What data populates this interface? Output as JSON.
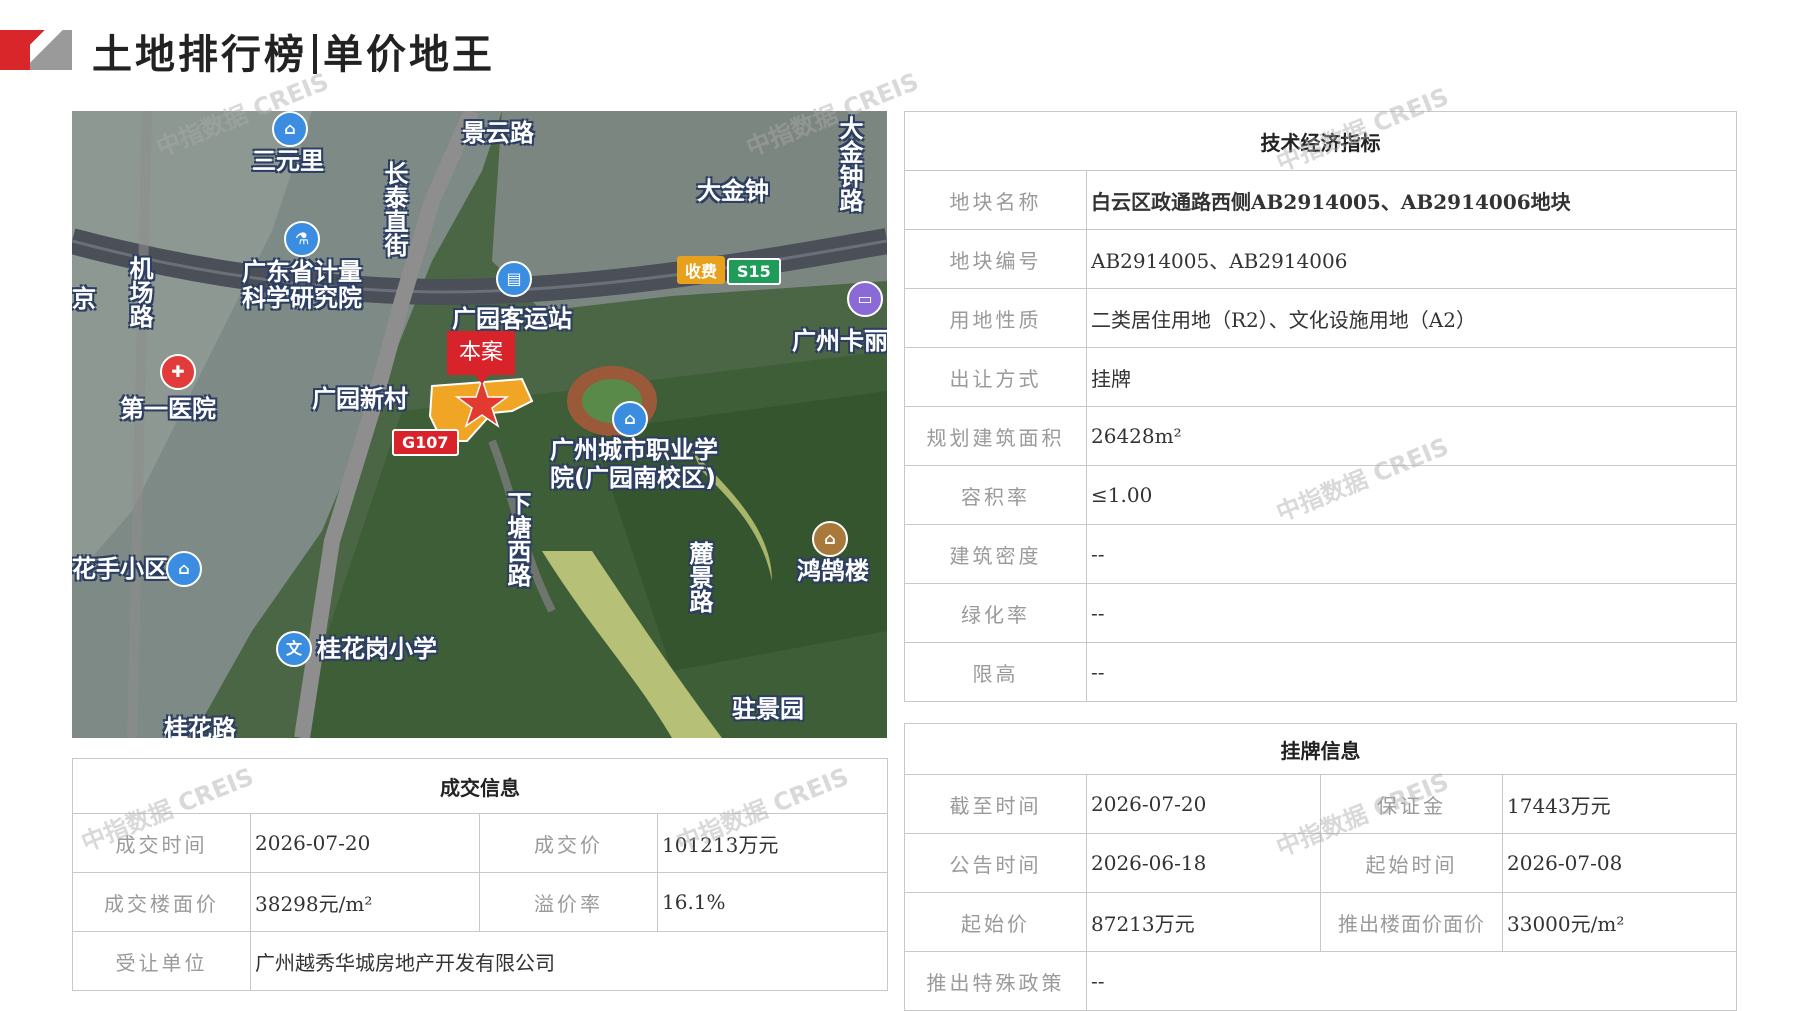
{
  "header": {
    "title_part1": "土地排行榜",
    "title_part2": "单价地王"
  },
  "watermark": "中指数据 CREIS",
  "map": {
    "case_label": "本案",
    "labels": {
      "jingyun_road": "景云路",
      "sanyuanli": "三元里",
      "daijinzhong_road": "大金钟路",
      "daijinzhong": "大金钟",
      "changtai": "长泰直街",
      "jichang_road": "机场路",
      "xingtan": "广东省计量科学研究院",
      "guangyuan_station": "广园客运站",
      "guangzhou_kalai": "广州卡丽",
      "first_hospital": "第一医院",
      "guangyuan_xincun": "广园新村",
      "vocational_college": "广州城市职业学院(广园南校区)",
      "xiatang_west_road": "下塘西路",
      "hongxi_lou": "鸿鹄楼",
      "huashou_xiaoqu": "花手小区",
      "guihuagang": "桂花岗小学",
      "guihua_road": "桂花路",
      "zhujing_yuan": "驻景园",
      "left_edge": "京",
      "lushan_road": "麓景路",
      "toll_badge": "收费",
      "s15_badge": "S15",
      "g107_badge": "G107"
    }
  },
  "tech": {
    "title": "技术经济指标",
    "rows": [
      {
        "label": "地块名称",
        "value": "白云区政通路西侧AB2914005、AB2914006地块"
      },
      {
        "label": "地块编号",
        "value": "AB2914005、AB2914006"
      },
      {
        "label": "用地性质",
        "value": "二类居住用地（R2）、文化设施用地（A2）"
      },
      {
        "label": "出让方式",
        "value": "挂牌"
      },
      {
        "label": "规划建筑面积",
        "value": "26428m²"
      },
      {
        "label": "容积率",
        "value": "≤1.00"
      },
      {
        "label": "建筑密度",
        "value": "--"
      },
      {
        "label": "绿化率",
        "value": "--"
      },
      {
        "label": "限高",
        "value": "--"
      }
    ]
  },
  "deal": {
    "title": "成交信息",
    "time_label": "成交时间",
    "time_value": "2026-07-20",
    "price_label": "成交价",
    "price_value": "101213万元",
    "floor_label": "成交楼面价",
    "floor_value": "38298元/m²",
    "premium_label": "溢价率",
    "premium_value": "16.1%",
    "buyer_label": "受让单位",
    "buyer_value": "广州越秀华城房地产开发有限公司"
  },
  "listing": {
    "title": "挂牌信息",
    "deadline_label": "截至时间",
    "deadline_value": "2026-07-20",
    "deposit_label": "保证金",
    "deposit_value": "17443万元",
    "announce_label": "公告时间",
    "announce_value": "2026-06-18",
    "start_time_label": "起始时间",
    "start_time_value": "2026-07-08",
    "start_price_label": "起始价",
    "start_price_value": "87213万元",
    "floor_price_label": "推出楼面价面价",
    "floor_price_value": "33000元/m²",
    "policy_label": "推出特殊政策",
    "policy_value": "--"
  }
}
